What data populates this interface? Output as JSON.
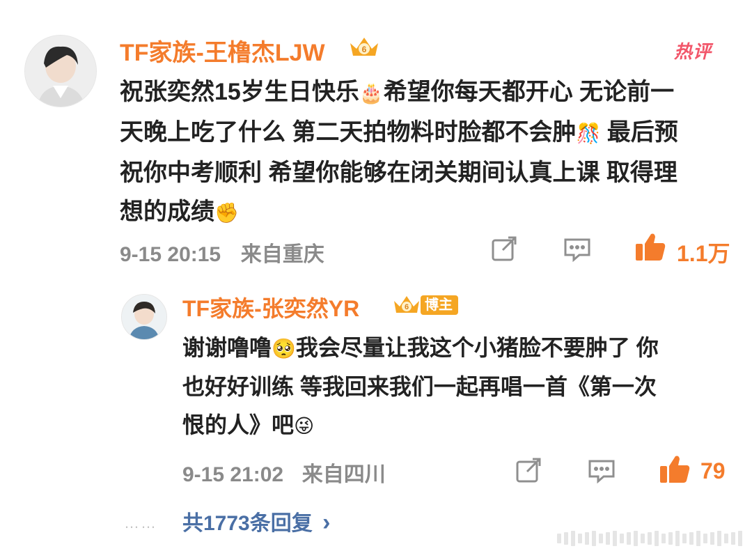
{
  "comment": {
    "author": "TF家族-王橹杰LJW",
    "hot_label": "热评",
    "text": "祝张奕然15岁生日快乐🎂希望你每天都开心 无论前一天晚上吃了什么 第二天拍物料时脸都不会肿🎊 最后预祝你中考顺利 希望你能够在闭关期间认真上课 取得理想的成绩✊",
    "line1": "祝张奕然15岁生日快乐",
    "line1_emoji": "🎂",
    "line1b": "希望你每天都开心 无论前一",
    "line2": "天晚上吃了什么 第二天拍物料时脸都不会肿",
    "line2_emoji": "🎊",
    "line2b": " 最后预",
    "line3": "祝你中考顺利 希望你能够在闭关期间认真上课 取得理",
    "line4": "想的成绩",
    "line4_emoji": "✊",
    "time": "9-15 20:15",
    "location": "来自重庆",
    "likes": "1.1万"
  },
  "reply": {
    "author": "TF家族-张奕然YR",
    "badge": "博主",
    "line1a": "谢谢噜噜",
    "line1_emoji": "🥺",
    "line1b": "我会尽量让我这个小猪脸不要肿了  你",
    "line2": "也好好训练 等我回来我们一起再唱一首《第一次",
    "line3": "恨的人》吧",
    "line3_emoji": "😜",
    "time": "9-15 21:02",
    "location": "来自四川",
    "likes": "79"
  },
  "more_replies": {
    "dots": "……",
    "label": "共1773条回复",
    "arrow": "›"
  },
  "colors": {
    "accent": "#f47c2c",
    "hot": "#f2566a",
    "meta": "#8a8a8a",
    "link": "#4a6fa5"
  }
}
